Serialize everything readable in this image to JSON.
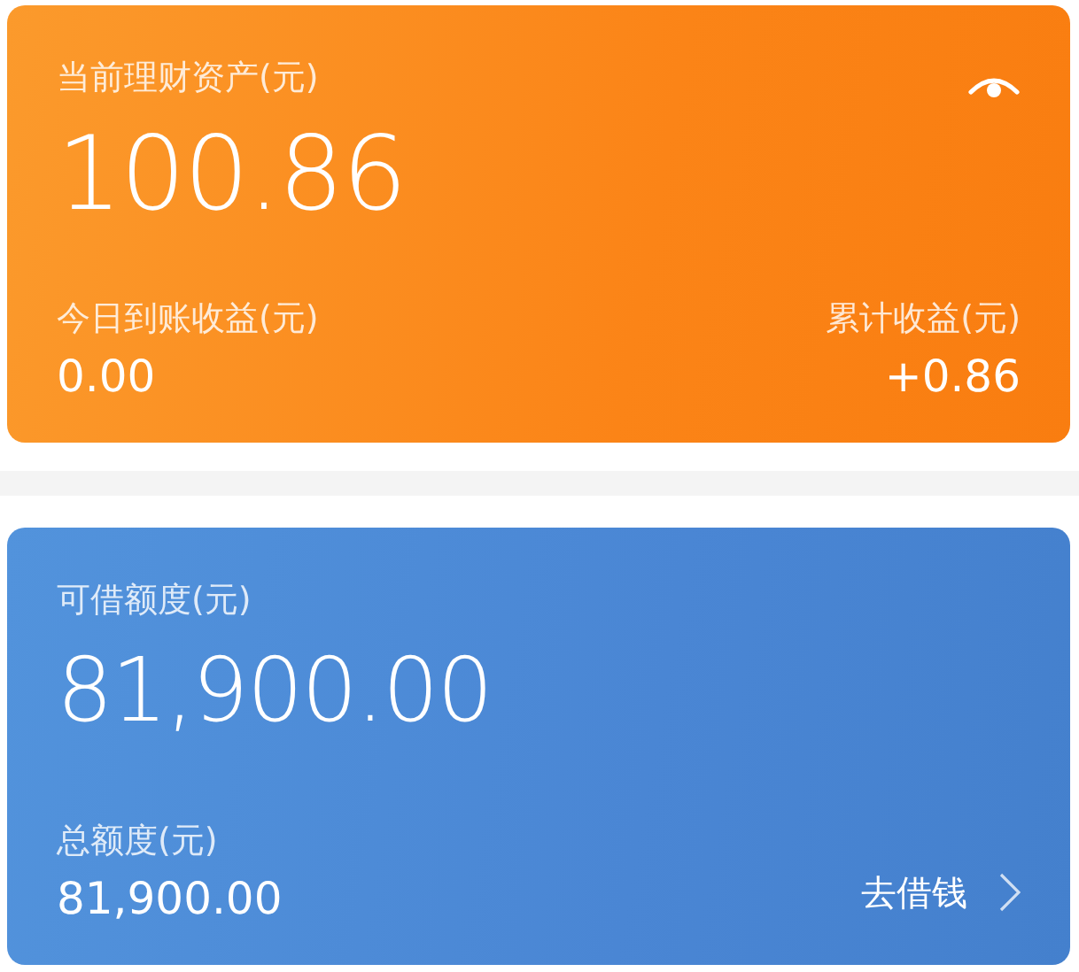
{
  "cards": [
    {
      "kind": "wealth",
      "title": "当前理财资产(元)",
      "amount": "100.86",
      "stats": [
        {
          "label": "今日到账收益(元)",
          "value": "0.00"
        },
        {
          "label": "累计收益(元)",
          "value": "+0.86"
        }
      ]
    },
    {
      "kind": "credit",
      "title": "可借额度(元)",
      "amount": "81,900.00",
      "stats": [
        {
          "label": "总额度(元)",
          "value": "81,900.00"
        }
      ],
      "action": "去借钱"
    }
  ]
}
